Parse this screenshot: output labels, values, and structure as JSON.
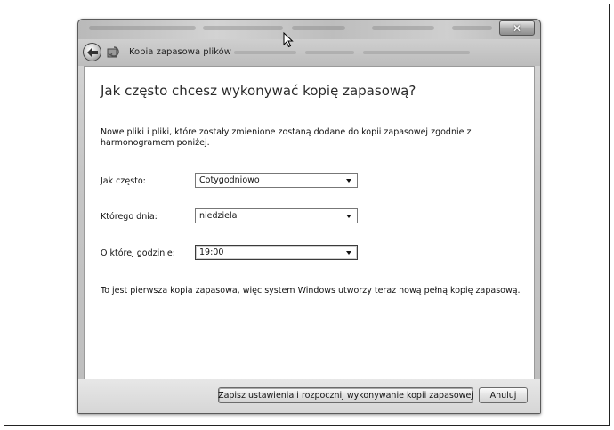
{
  "window": {
    "nav_title": "Kopia zapasowa plików",
    "close_symbol": "✕"
  },
  "content": {
    "heading": "Jak często chcesz wykonywać kopię zapasową?",
    "description": "Nowe pliki i pliki, które zostały zmienione zostaną dodane do kopii zapasowej zgodnie z harmonogramem poniżej.",
    "frequency": {
      "label": "Jak często:",
      "value": "Cotygodniowo"
    },
    "day": {
      "label": "Którego dnia:",
      "value": "niedziela"
    },
    "time": {
      "label": "O której godzinie:",
      "value": "19:00"
    },
    "info": "To jest pierwsza kopia zapasowa, więc system Windows utworzy teraz nową pełną kopię zapasową."
  },
  "footer": {
    "save_label": "Zapisz ustawienia i rozpocznij wykonywanie kopii zapasowej",
    "cancel_label": "Anuluj"
  },
  "icons": {
    "back": "back-arrow-icon",
    "app": "backup-icon",
    "close": "close-icon",
    "cursor": "mouse-cursor-icon",
    "dropdown": "chevron-down-icon"
  }
}
